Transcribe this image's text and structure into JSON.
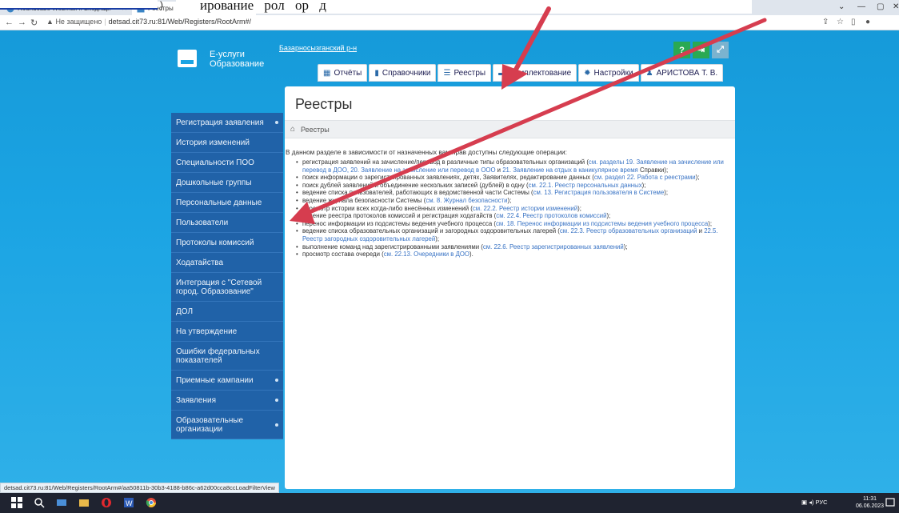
{
  "browser": {
    "tabs": [
      {
        "label": "Roundcube Webmail :: Входящи"
      },
      {
        "label": "Реестры"
      }
    ],
    "new_tab": "+",
    "url_warning": "Не защищено",
    "url": "detsad.cit73.ru:81/Web/Registers/RootArm#/",
    "status_url": "detsad.cit73.ru:81/Web/Registers/RootArm#/aa50811b-30b3-4188-b86c-a62d00cca8ccLoadFilterView"
  },
  "overlay_text": "ирование                 рол               ор           д",
  "header": {
    "logo_line1": "Е-услуги",
    "logo_line2": "Образование",
    "region": "Базарносызганский р-н"
  },
  "nav_tabs": [
    {
      "label": "Отчёты",
      "icon": "report-icon"
    },
    {
      "label": "Справочники",
      "icon": "book-icon"
    },
    {
      "label": "Реестры",
      "icon": "list-icon"
    },
    {
      "label": "Комплектование",
      "icon": "card-icon"
    },
    {
      "label": "Настройки",
      "icon": "gear-icon"
    },
    {
      "label": "АРИСТОВА Т. В.",
      "icon": "user-icon"
    }
  ],
  "sidebar": {
    "items": [
      {
        "label": "Регистрация заявления",
        "expand": true
      },
      {
        "label": "История изменений",
        "expand": false
      },
      {
        "label": "Специальности ПОО",
        "expand": false
      },
      {
        "label": "Дошкольные группы",
        "expand": false
      },
      {
        "label": "Персональные данные",
        "expand": false
      },
      {
        "label": "Пользователи",
        "expand": false
      },
      {
        "label": "Протоколы комиссий",
        "expand": false
      },
      {
        "label": "Ходатайства",
        "expand": false
      },
      {
        "label": "Интеграция с \"Сетевой город. Образование\"",
        "expand": false
      },
      {
        "label": "ДОЛ",
        "expand": false
      },
      {
        "label": "На утверждение",
        "expand": false
      },
      {
        "label": "Ошибки федеральных показателей",
        "expand": false
      },
      {
        "label": "Приемные кампании",
        "expand": true
      },
      {
        "label": "Заявления",
        "expand": true
      },
      {
        "label": "Образовательные организации",
        "expand": true
      }
    ]
  },
  "content": {
    "title": "Реестры",
    "breadcrumb": "Реестры",
    "intro": "В данном разделе в зависимости от назначенных вам прав доступны следующие операции:",
    "operations": [
      {
        "text": "регистрация заявлений на зачисление/перевод в различные типы образовательных организаций (",
        "link": "см. разделы 19. Заявление на зачисление или перевод в ДОО, 20. Заявление на зачисление или перевод в ООО",
        "text2": " и ",
        "link2": "21. Заявление на отдых в каникулярное время",
        "text3": " Справки);"
      },
      {
        "text": "поиск информации о зарегистрированных заявлениях, детях, Заявителях, редактирование данных (",
        "link": "см. раздел 22. Работа с реестрами",
        "text2": ");",
        "link2": "",
        "text3": ""
      },
      {
        "text": "поиск дублей заявлений и объединение нескольких записей (дублей) в одну (",
        "link": "см. 22.1. Реестр персональных данных",
        "text2": ");",
        "link2": "",
        "text3": ""
      },
      {
        "text": "ведение списка пользователей, работающих в ведомственной части Системы (",
        "link": "см. 13. Регистрация пользователя в Системе",
        "text2": ");",
        "link2": "",
        "text3": ""
      },
      {
        "text": "ведение журнала безопасности Системы (",
        "link": "см. 8. Журнал безопасности",
        "text2": ");",
        "link2": "",
        "text3": ""
      },
      {
        "text": "просмотр истории всех когда-либо внесённых изменений (",
        "link": "см. 22.2. Реестр истории изменений",
        "text2": ");",
        "link2": "",
        "text3": ""
      },
      {
        "text": "ведение реестра протоколов комиссий и регистрация ходатайств (",
        "link": "см. 22.4. Реестр протоколов комиссий",
        "text2": ");",
        "link2": "",
        "text3": ""
      },
      {
        "text": "перенос информации из подсистемы ведения учебного процесса (",
        "link": "см. 18. Перенос информации из подсистемы ведения учебного процесса",
        "text2": ");",
        "link2": "",
        "text3": ""
      },
      {
        "text": "ведение списка образовательных организаций и загородных оздоровительных лагерей (",
        "link": "см. 22.3. Реестр образовательных организаций",
        "text2": " и ",
        "link2": "22.5. Реестр загородных оздоровительных лагерей",
        "text3": ");"
      },
      {
        "text": "выполнение команд над зарегистрированными заявлениями (",
        "link": "см. 22.6. Реестр зарегистрированных заявлений",
        "text2": ");",
        "link2": "",
        "text3": ""
      },
      {
        "text": "просмотр состава очереди (",
        "link": "см. 22.13. Очередники в ДОО",
        "text2": ").",
        "link2": "",
        "text3": ""
      }
    ]
  },
  "taskbar": {
    "lang": "РУС",
    "time": "11:31",
    "date": "06.06.2023"
  },
  "colors": {
    "page_bg": "#1ba4e3",
    "sidebar_bg": "#2062a8",
    "link": "#3a74c5",
    "arrow": "#d63d4f"
  }
}
